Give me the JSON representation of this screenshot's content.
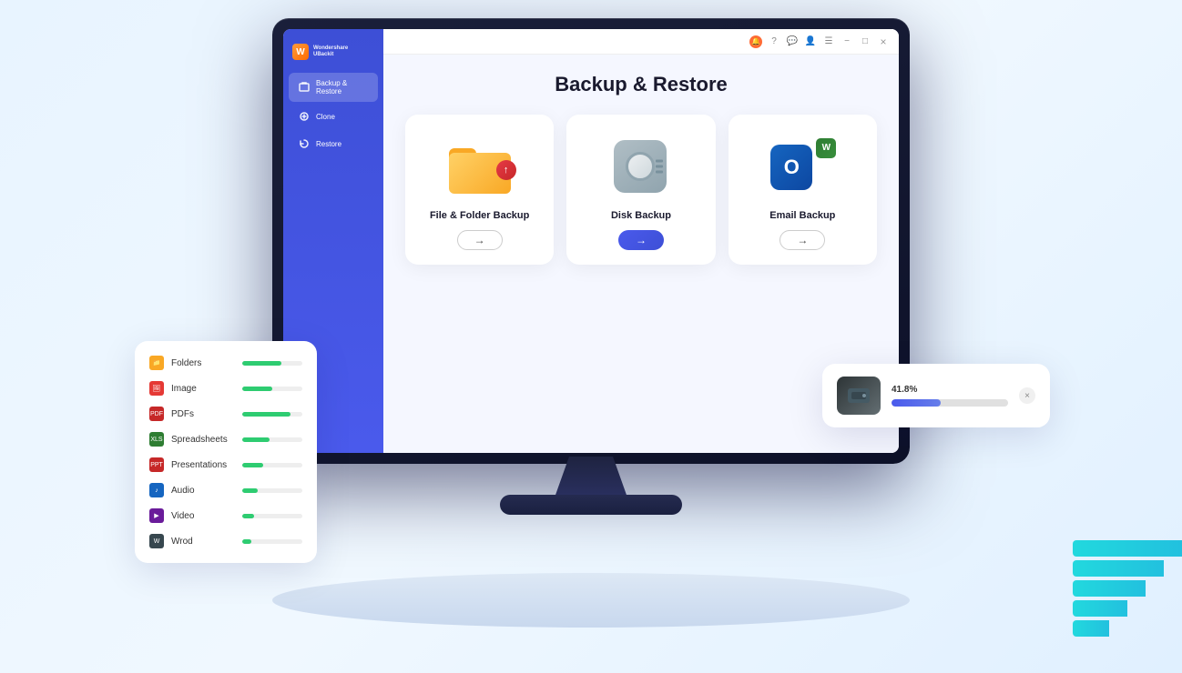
{
  "app": {
    "title": "Wondershare UBackit",
    "logo_text": "Wondershare\nUBackit"
  },
  "sidebar": {
    "items": [
      {
        "id": "backup-restore",
        "label": "Backup & Restore",
        "active": true
      },
      {
        "id": "clone",
        "label": "Clone",
        "active": false
      },
      {
        "id": "restore",
        "label": "Restore",
        "active": false
      }
    ]
  },
  "window_chrome": {
    "minimize_label": "−",
    "maximize_label": "□",
    "close_label": "×"
  },
  "main": {
    "page_title": "Backup & Restore",
    "cards": [
      {
        "id": "file-folder",
        "label": "File & Folder Backup",
        "btn_label": "→",
        "btn_active": false
      },
      {
        "id": "disk",
        "label": "Disk Backup",
        "btn_label": "→",
        "btn_active": true
      },
      {
        "id": "email",
        "label": "Email Backup",
        "btn_label": "→",
        "btn_active": false
      }
    ]
  },
  "float_left": {
    "items": [
      {
        "label": "Folders",
        "fill": 65,
        "color": "#2ecc71"
      },
      {
        "label": "Image",
        "fill": 50,
        "color": "#2ecc71"
      },
      {
        "label": "PDFs",
        "fill": 80,
        "color": "#2ecc71"
      },
      {
        "label": "Spreadsheets",
        "fill": 45,
        "color": "#2ecc71"
      },
      {
        "label": "Presentations",
        "fill": 35,
        "color": "#2ecc71"
      },
      {
        "label": "Audio",
        "fill": 25,
        "color": "#2ecc71"
      },
      {
        "label": "Video",
        "fill": 20,
        "color": "#2ecc71"
      },
      {
        "label": "Wrod",
        "fill": 15,
        "color": "#2ecc71"
      }
    ]
  },
  "float_right": {
    "progress_percent": "41.8%",
    "progress_value": 42,
    "close_label": "×"
  },
  "teal_steps": {
    "widths": [
      120,
      100,
      80,
      60,
      40
    ]
  }
}
